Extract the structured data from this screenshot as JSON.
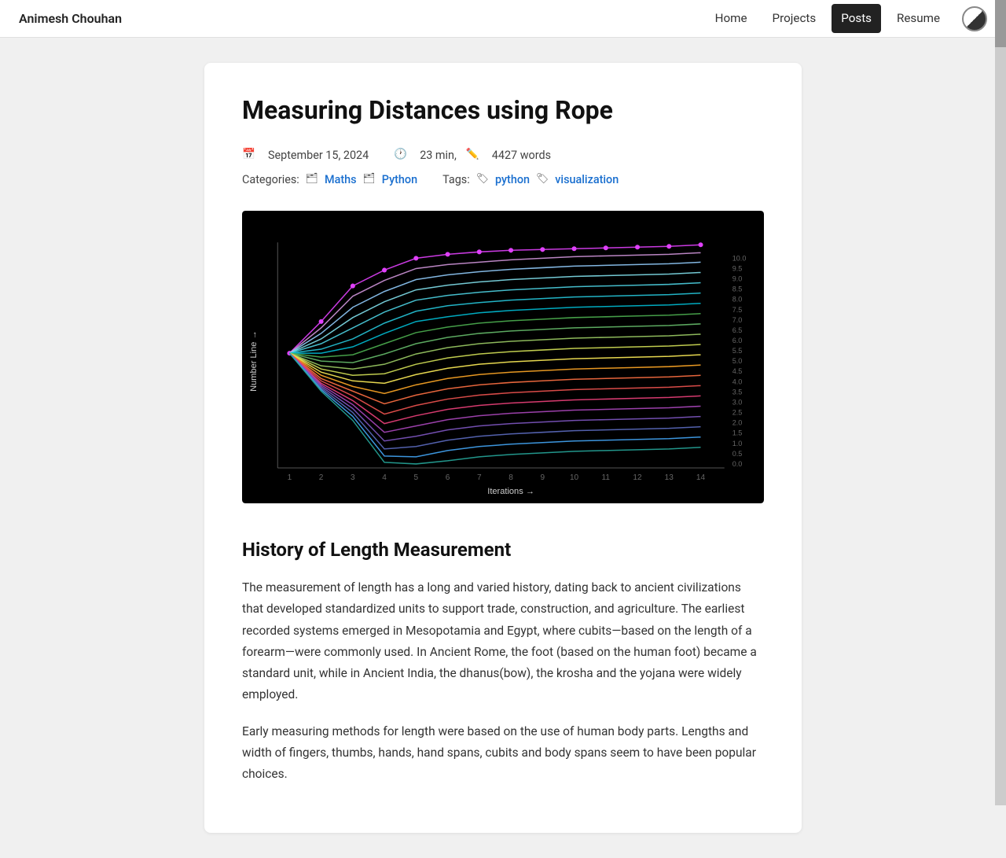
{
  "nav": {
    "brand": "Animesh Chouhan",
    "links": [
      {
        "label": "Home",
        "active": false
      },
      {
        "label": "Projects",
        "active": false
      },
      {
        "label": "Posts",
        "active": true
      },
      {
        "label": "Resume",
        "active": false
      }
    ]
  },
  "post": {
    "title": "Measuring Distances using Rope",
    "date": "September 15, 2024",
    "read_time": "23 min,",
    "word_count": "4427 words",
    "categories_label": "Categories:",
    "categories": [
      "Maths",
      "Python"
    ],
    "tags_label": "Tags:",
    "tags": [
      "python",
      "visualization"
    ],
    "section_title": "History of Length Measurement",
    "paragraph1": "The measurement of length has a long and varied history, dating back to ancient civilizations that developed standardized units to support trade, construction, and agriculture. The earliest recorded systems emerged in Mesopotamia and Egypt, where cubits—based on the length of a forearm—were commonly used. In Ancient Rome, the foot (based on the human foot) became a standard unit, while in Ancient India, the dhanus(bow), the krosha and the yojana were widely employed.",
    "paragraph2": "Early measuring methods for length were based on the use of human body parts. Lengths and width of fingers, thumbs, hands, hand spans, cubits and body spans seem to have been popular choices."
  },
  "chart": {
    "x_label": "Iterations →",
    "y_label": "Number Line →",
    "x_ticks": [
      "1",
      "2",
      "3",
      "4",
      "5",
      "6",
      "7",
      "8",
      "9",
      "10",
      "11",
      "12",
      "13",
      "14"
    ],
    "y_ticks": [
      "0.0",
      "0.5",
      "1.0",
      "1.5",
      "2.0",
      "2.5",
      "3.0",
      "3.5",
      "4.0",
      "4.5",
      "5.0",
      "5.5",
      "6.0",
      "6.5",
      "7.0",
      "7.5",
      "8.0",
      "8.5",
      "9.0",
      "9.5",
      "10.0"
    ]
  }
}
